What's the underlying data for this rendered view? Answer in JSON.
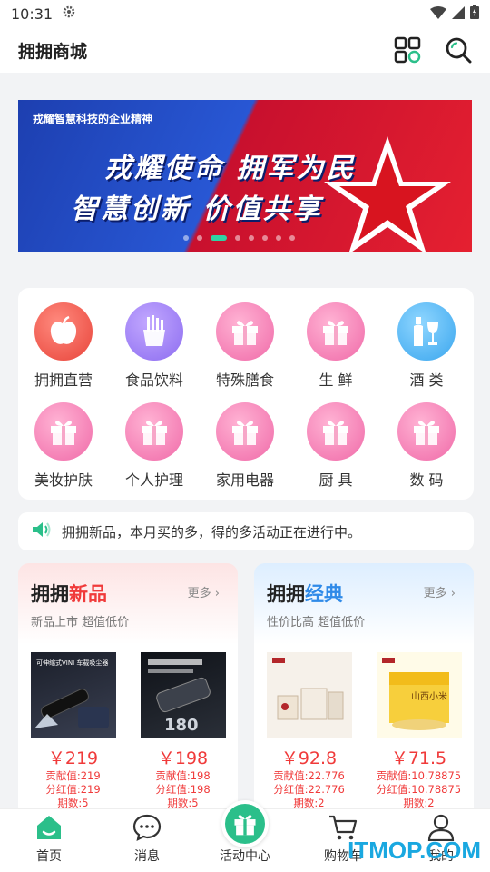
{
  "status_bar": {
    "time": "10:31"
  },
  "header": {
    "title": "拥拥商城"
  },
  "banner": {
    "top_text": "戎耀智慧科技的企业精神",
    "line1": "戎耀使命  拥军为民",
    "line2": "智慧创新  价值共享",
    "slide_count": 8,
    "active_slide": 3
  },
  "categories": [
    {
      "label": "拥拥直营",
      "icon": "apple-icon",
      "color": "red"
    },
    {
      "label": "食品饮料",
      "icon": "fries-icon",
      "color": "purple"
    },
    {
      "label": "特殊膳食",
      "icon": "gift-icon",
      "color": "pink"
    },
    {
      "label": "生 鲜",
      "icon": "gift-icon",
      "color": "pink"
    },
    {
      "label": "酒 类",
      "icon": "wine-icon",
      "color": "blue"
    },
    {
      "label": "美妆护肤",
      "icon": "gift-icon",
      "color": "pink"
    },
    {
      "label": "个人护理",
      "icon": "gift-icon",
      "color": "pink"
    },
    {
      "label": "家用电器",
      "icon": "gift-icon",
      "color": "pink"
    },
    {
      "label": "厨 具",
      "icon": "gift-icon",
      "color": "pink"
    },
    {
      "label": "数 码",
      "icon": "gift-icon",
      "color": "pink"
    }
  ],
  "notice": {
    "text": "拥拥新品，本月买的多，得的多活动正在进行中。"
  },
  "sections": [
    {
      "title_dark": "拥拥",
      "title_accent": "新品",
      "more": "更多",
      "subtitle": "新品上市 超值低价",
      "products": [
        {
          "price": "￥219",
          "contribution": "贡献值:219",
          "dividend": "分红值:219",
          "periods": "期数:5",
          "image_text": "可伸缩式VINI 车载吸尘器"
        },
        {
          "price": "￥198",
          "contribution": "贡献值:198",
          "dividend": "分红值:198",
          "periods": "期数:5",
          "image_text": "180"
        }
      ]
    },
    {
      "title_dark": "拥拥",
      "title_accent": "经典",
      "more": "更多",
      "subtitle": "性价比高 超值低价",
      "products": [
        {
          "price": "￥92.8",
          "contribution": "贡献值:22.776",
          "dividend": "分红值:22.776",
          "periods": "期数:2",
          "image_text": ""
        },
        {
          "price": "￥71.5",
          "contribution": "贡献值:10.78875",
          "dividend": "分红值:10.78875",
          "periods": "期数:2",
          "image_text": "山西小米"
        }
      ]
    }
  ],
  "tabbar": [
    {
      "label": "首页",
      "icon": "home-icon",
      "active": true
    },
    {
      "label": "消息",
      "icon": "message-icon",
      "active": false
    },
    {
      "label": "活动中心",
      "icon": "gift-icon",
      "active": false
    },
    {
      "label": "购物车",
      "icon": "cart-icon",
      "active": false
    },
    {
      "label": "我的",
      "icon": "user-icon",
      "active": false
    }
  ],
  "watermark": "ITMOP.COM",
  "colors": {
    "brand_green": "#2bbf8a",
    "price_red": "#f03a3a",
    "classic_blue": "#2f8ae8"
  }
}
